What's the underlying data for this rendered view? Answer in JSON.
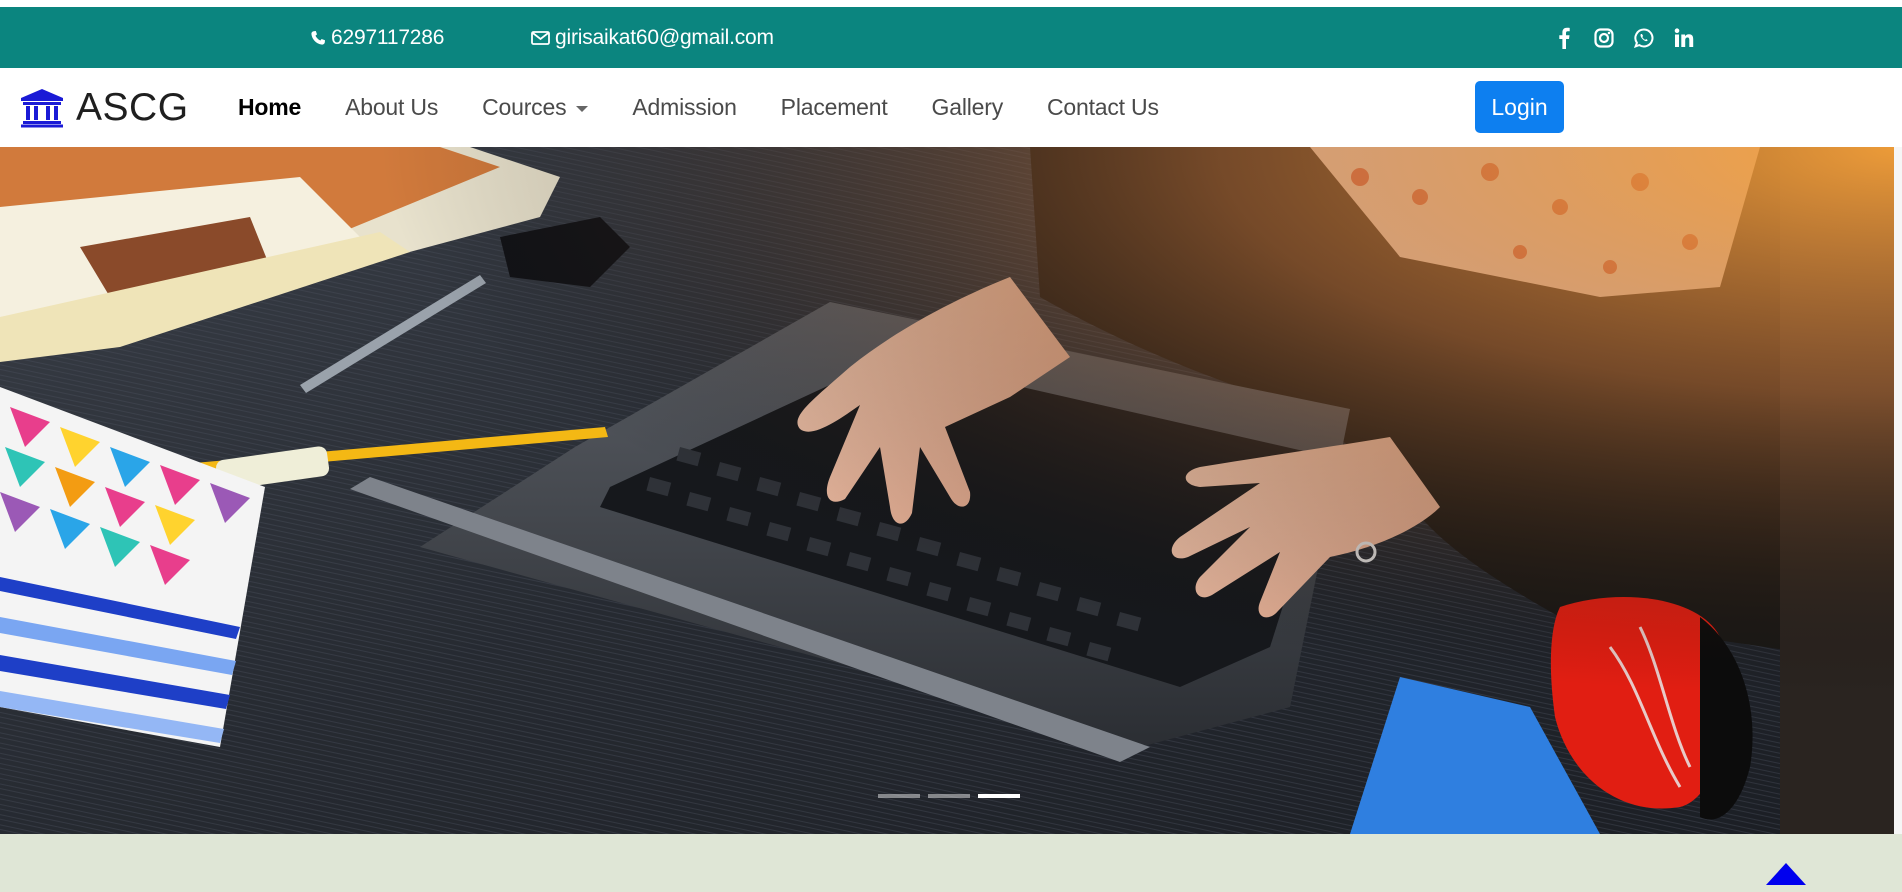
{
  "topbar": {
    "phone": "6297117286",
    "email": "girisaikat60@gmail.com",
    "social": [
      "facebook-icon",
      "instagram-icon",
      "whatsapp-icon",
      "linkedin-icon"
    ],
    "bg_color": "#0b857f"
  },
  "brand": {
    "logo_icon": "institution-icon",
    "name": "ASCG",
    "icon_color": "#1a1ad6"
  },
  "nav": {
    "items": [
      {
        "label": "Home",
        "active": true
      },
      {
        "label": "About Us"
      },
      {
        "label": "Cources",
        "dropdown": true
      },
      {
        "label": "Admission"
      },
      {
        "label": "Placement"
      },
      {
        "label": "Gallery"
      },
      {
        "label": "Contact Us"
      }
    ],
    "login_label": "Login",
    "login_color": "#0d7ff0"
  },
  "hero": {
    "slide_count": 3,
    "active_slide": 3
  },
  "bottom": {
    "bg_color": "#dfe6d6",
    "scroll_top_icon": "arrow-up-icon",
    "scroll_top_color": "#0000ee"
  }
}
